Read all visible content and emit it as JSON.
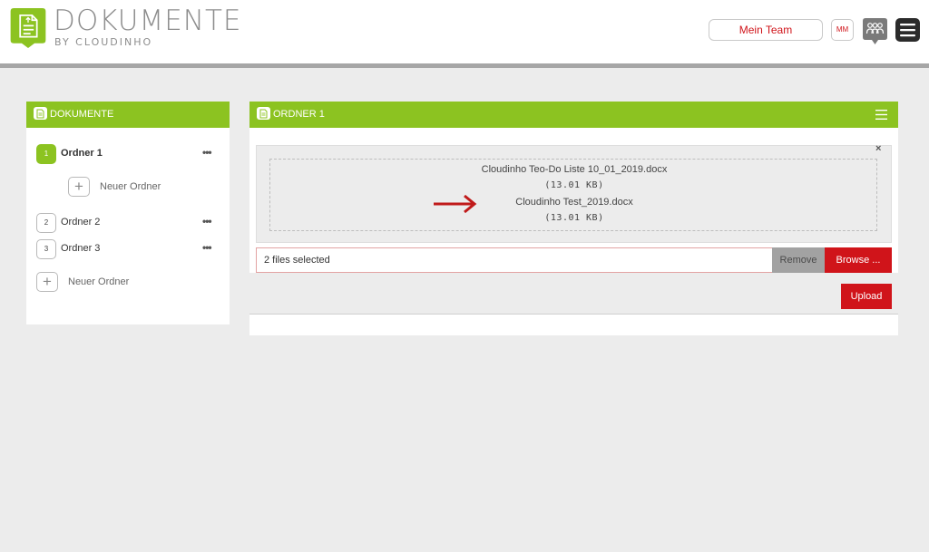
{
  "header": {
    "logo_title": "DOKUMENTE",
    "logo_sub": "BY CLOUDINHO",
    "team_button": "Mein Team",
    "user_initials": "MM",
    "icons": [
      "document-logo-icon",
      "people-icon",
      "menu-icon"
    ],
    "colors": {
      "brand_green": "#8cc321",
      "accent_red": "#d0141a"
    }
  },
  "sidebar": {
    "title": "DOKUMENTE",
    "folders": [
      {
        "number": "1",
        "label": "Ordner 1",
        "menu": "•••",
        "active": true
      },
      {
        "number": "2",
        "label": "Ordner 2",
        "menu": "•••",
        "active": false
      },
      {
        "number": "3",
        "label": "Ordner 3",
        "menu": "•••",
        "active": false
      }
    ],
    "new_folder_sub": {
      "plus": "+",
      "label": "Neuer Ordner"
    },
    "new_folder": {
      "plus": "+",
      "label": "Neuer Ordner"
    }
  },
  "main": {
    "title": "ORDNER 1",
    "close": "×",
    "files": [
      {
        "name": "Cloudinho Teo-Do Liste 10_01_2019.docx",
        "size": "(13.01 KB)"
      },
      {
        "name": "Cloudinho Test_2019.docx",
        "size": "(13.01 KB)"
      }
    ],
    "file_input_value": "2 files selected",
    "remove_label": "Remove",
    "browse_label": "Browse ...",
    "upload_label": "Upload"
  }
}
